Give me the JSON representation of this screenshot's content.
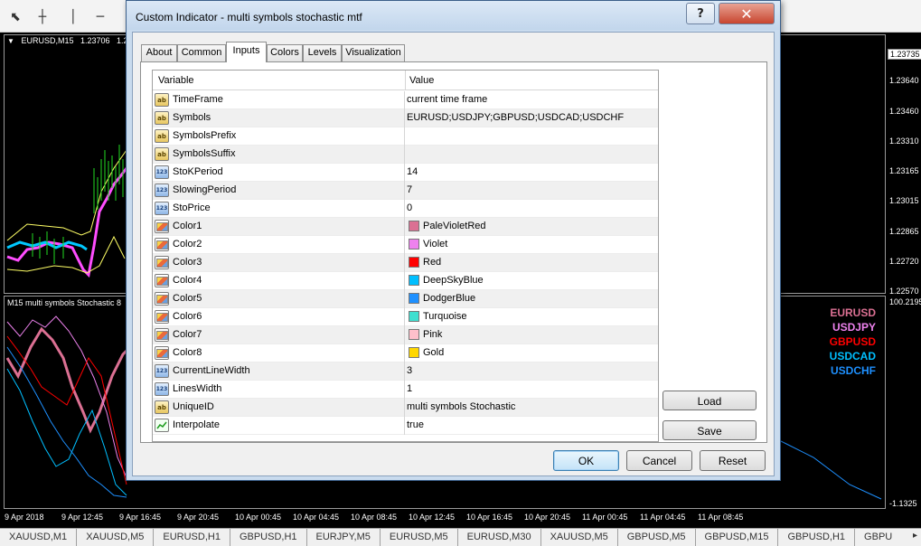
{
  "terminal": {
    "chart_title": [
      "EURUSD,M15",
      "1.23706",
      "1.23"
    ],
    "subwindow_title": "M15 multi symbols Stochastic 8",
    "current_price": "1.23735",
    "price_scale": [
      "1.23640",
      "1.23460",
      "1.23310",
      "1.23165",
      "1.23015",
      "1.22865",
      "1.22720",
      "1.22570"
    ],
    "subwindow_scale_top": "100.2195",
    "subwindow_scale_bottom": "-1.1325",
    "date_labels": [
      "9 Apr 2018",
      "9 Apr 12:45",
      "9 Apr 16:45",
      "9 Apr 20:45",
      "10 Apr 00:45",
      "10 Apr 04:45",
      "10 Apr 08:45",
      "10 Apr 12:45",
      "10 Apr 16:45",
      "10 Apr 20:45",
      "11 Apr 00:45",
      "11 Apr 04:45",
      "11 Apr 08:45"
    ],
    "symbol_legend": [
      {
        "name": "EURUSD",
        "color": "#DB7093"
      },
      {
        "name": "USDJPY",
        "color": "#EE82EE"
      },
      {
        "name": "GBPUSD",
        "color": "#FF0000"
      },
      {
        "name": "USDCAD",
        "color": "#00BFFF"
      },
      {
        "name": "USDCHF",
        "color": "#1E90FF"
      }
    ],
    "symbol_tabs": [
      "XAUUSD,M1",
      "XAUUSD,M5",
      "EURUSD,H1",
      "GBPUSD,H1",
      "EURJPY,M5",
      "EURUSD,M5",
      "EURUSD,M30",
      "XAUUSD,M5",
      "GBPUSD,M5",
      "GBPUSD,M15",
      "GBPUSD,H1",
      "GBPU"
    ],
    "scroll_arrow_icon": "arrow-right-icon"
  },
  "dialog": {
    "title": "Custom Indicator - multi symbols stochastic mtf",
    "help_label": "?",
    "close_label": "✕",
    "tabs": [
      "About",
      "Common",
      "Inputs",
      "Colors",
      "Levels",
      "Visualization"
    ],
    "active_tab": "Inputs",
    "grid": {
      "col_variable": "Variable",
      "col_value": "Value",
      "rows": [
        {
          "type": "ab",
          "name": "TimeFrame",
          "value": "current time frame"
        },
        {
          "type": "ab",
          "name": "Symbols",
          "value": "EURUSD;USDJPY;GBPUSD;USDCAD;USDCHF"
        },
        {
          "type": "ab",
          "name": "SymbolsPrefix",
          "value": ""
        },
        {
          "type": "ab",
          "name": "SymbolsSuffix",
          "value": ""
        },
        {
          "type": "123",
          "name": "StoKPeriod",
          "value": "14"
        },
        {
          "type": "123",
          "name": "SlowingPeriod",
          "value": "7"
        },
        {
          "type": "123",
          "name": "StoPrice",
          "value": "0"
        },
        {
          "type": "color",
          "name": "Color1",
          "value": "PaleVioletRed",
          "swatch": "#DB7093"
        },
        {
          "type": "color",
          "name": "Color2",
          "value": "Violet",
          "swatch": "#EE82EE"
        },
        {
          "type": "color",
          "name": "Color3",
          "value": "Red",
          "swatch": "#FF0000"
        },
        {
          "type": "color",
          "name": "Color4",
          "value": "DeepSkyBlue",
          "swatch": "#00BFFF"
        },
        {
          "type": "color",
          "name": "Color5",
          "value": "DodgerBlue",
          "swatch": "#1E90FF"
        },
        {
          "type": "color",
          "name": "Color6",
          "value": "Turquoise",
          "swatch": "#40E0D0"
        },
        {
          "type": "color",
          "name": "Color7",
          "value": "Pink",
          "swatch": "#FFC0CB"
        },
        {
          "type": "color",
          "name": "Color8",
          "value": "Gold",
          "swatch": "#FFD700"
        },
        {
          "type": "123",
          "name": "CurrentLineWidth",
          "value": "3"
        },
        {
          "type": "123",
          "name": "LinesWidth",
          "value": "1"
        },
        {
          "type": "ab",
          "name": "UniqueID",
          "value": "multi symbols Stochastic"
        },
        {
          "type": "bool",
          "name": "Interpolate",
          "value": "true"
        }
      ]
    },
    "load_label": "Load",
    "save_label": "Save",
    "ok_label": "OK",
    "cancel_label": "Cancel",
    "reset_label": "Reset"
  }
}
